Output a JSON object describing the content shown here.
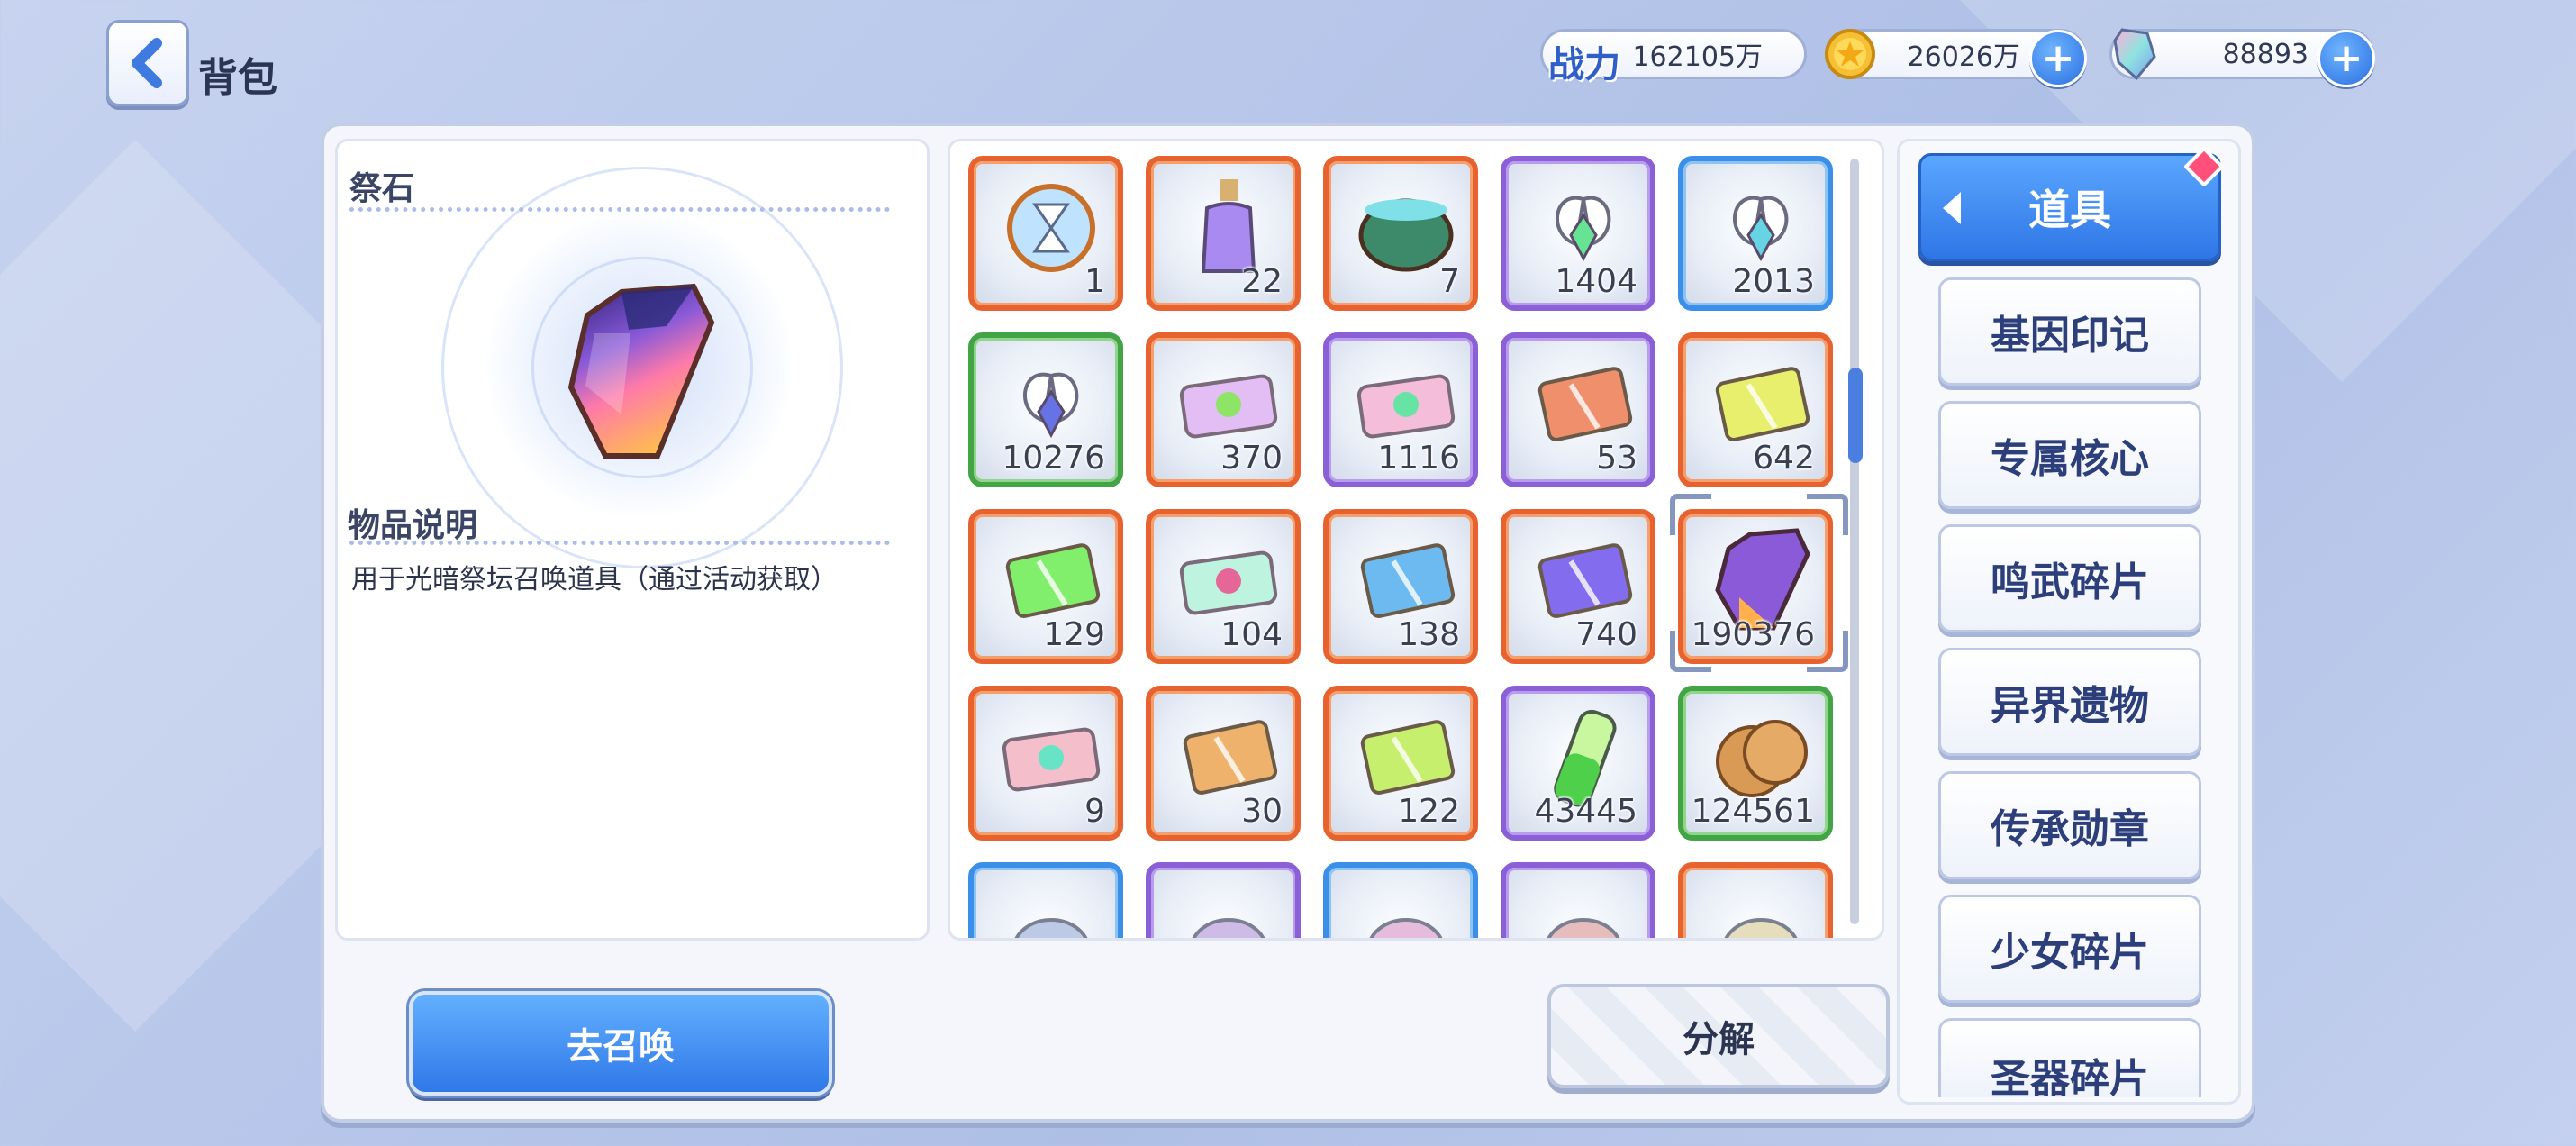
{
  "header": {
    "title": "背包",
    "power_label": "战力",
    "power_value": "162105万",
    "gold_value": "26026万",
    "gem_value": "88893"
  },
  "detail": {
    "item_name": "祭石",
    "desc_title": "物品说明",
    "desc_text": "用于光暗祭坛召唤道具（通过活动获取）"
  },
  "items": [
    {
      "icon": "hourglass-orb-icon",
      "qty": "1",
      "rarity": "orange"
    },
    {
      "icon": "potion-bottle-icon",
      "qty": "22",
      "rarity": "orange"
    },
    {
      "icon": "cauldron-icon",
      "qty": "7",
      "rarity": "orange"
    },
    {
      "icon": "wing-fragment-purple-icon",
      "qty": "1404",
      "rarity": "purple"
    },
    {
      "icon": "wing-fragment-blue-icon",
      "qty": "2013",
      "rarity": "blue"
    },
    {
      "icon": "wing-fragment-green-icon",
      "qty": "10276",
      "rarity": "green"
    },
    {
      "icon": "outfit-ticket-icon",
      "qty": "370",
      "rarity": "orange"
    },
    {
      "icon": "smile-ticket-icon",
      "qty": "1116",
      "rarity": "purple"
    },
    {
      "icon": "dna-card-gold-icon",
      "qty": "53",
      "rarity": "purple"
    },
    {
      "icon": "star-card-gold-icon",
      "qty": "642",
      "rarity": "orange"
    },
    {
      "icon": "dna-card-rainbow-icon",
      "qty": "129",
      "rarity": "orange"
    },
    {
      "icon": "rainbow-ticket-icon",
      "qty": "104",
      "rarity": "orange"
    },
    {
      "icon": "sword-card-gold-icon",
      "qty": "138",
      "rarity": "orange"
    },
    {
      "icon": "sword-card-purple-icon",
      "qty": "740",
      "rarity": "orange"
    },
    {
      "icon": "sacrifice-stone-icon",
      "qty": "190376",
      "rarity": "orange"
    },
    {
      "icon": "heart-ticket-icon",
      "qty": "9",
      "rarity": "orange"
    },
    {
      "icon": "sparkle-card-gold-icon",
      "qty": "30",
      "rarity": "orange"
    },
    {
      "icon": "sparkle-card-purple-icon",
      "qty": "122",
      "rarity": "orange"
    },
    {
      "icon": "green-vial-icon",
      "qty": "43445",
      "rarity": "purple"
    },
    {
      "icon": "cookie-icon",
      "qty": "124561",
      "rarity": "green"
    },
    {
      "icon": "partial-item-icon",
      "qty": "",
      "rarity": "blue"
    },
    {
      "icon": "partial-item-icon",
      "qty": "",
      "rarity": "purple"
    },
    {
      "icon": "partial-item-icon",
      "qty": "",
      "rarity": "blue"
    },
    {
      "icon": "partial-item-icon",
      "qty": "",
      "rarity": "purple"
    },
    {
      "icon": "partial-item-icon",
      "qty": "",
      "rarity": "orange"
    }
  ],
  "categories": {
    "active": "道具",
    "list": [
      "基因印记",
      "专属核心",
      "鸣武碎片",
      "异界遗物",
      "传承勋章",
      "少女碎片",
      "圣器碎片"
    ]
  },
  "actions": {
    "summon": "去召唤",
    "decompose": "分解"
  },
  "colors": {
    "accent_blue": "#2f78e8",
    "rarity_orange": "#e8622f",
    "rarity_purple": "#8b5fd6",
    "rarity_blue": "#3c8fe8",
    "rarity_green": "#43a446"
  }
}
